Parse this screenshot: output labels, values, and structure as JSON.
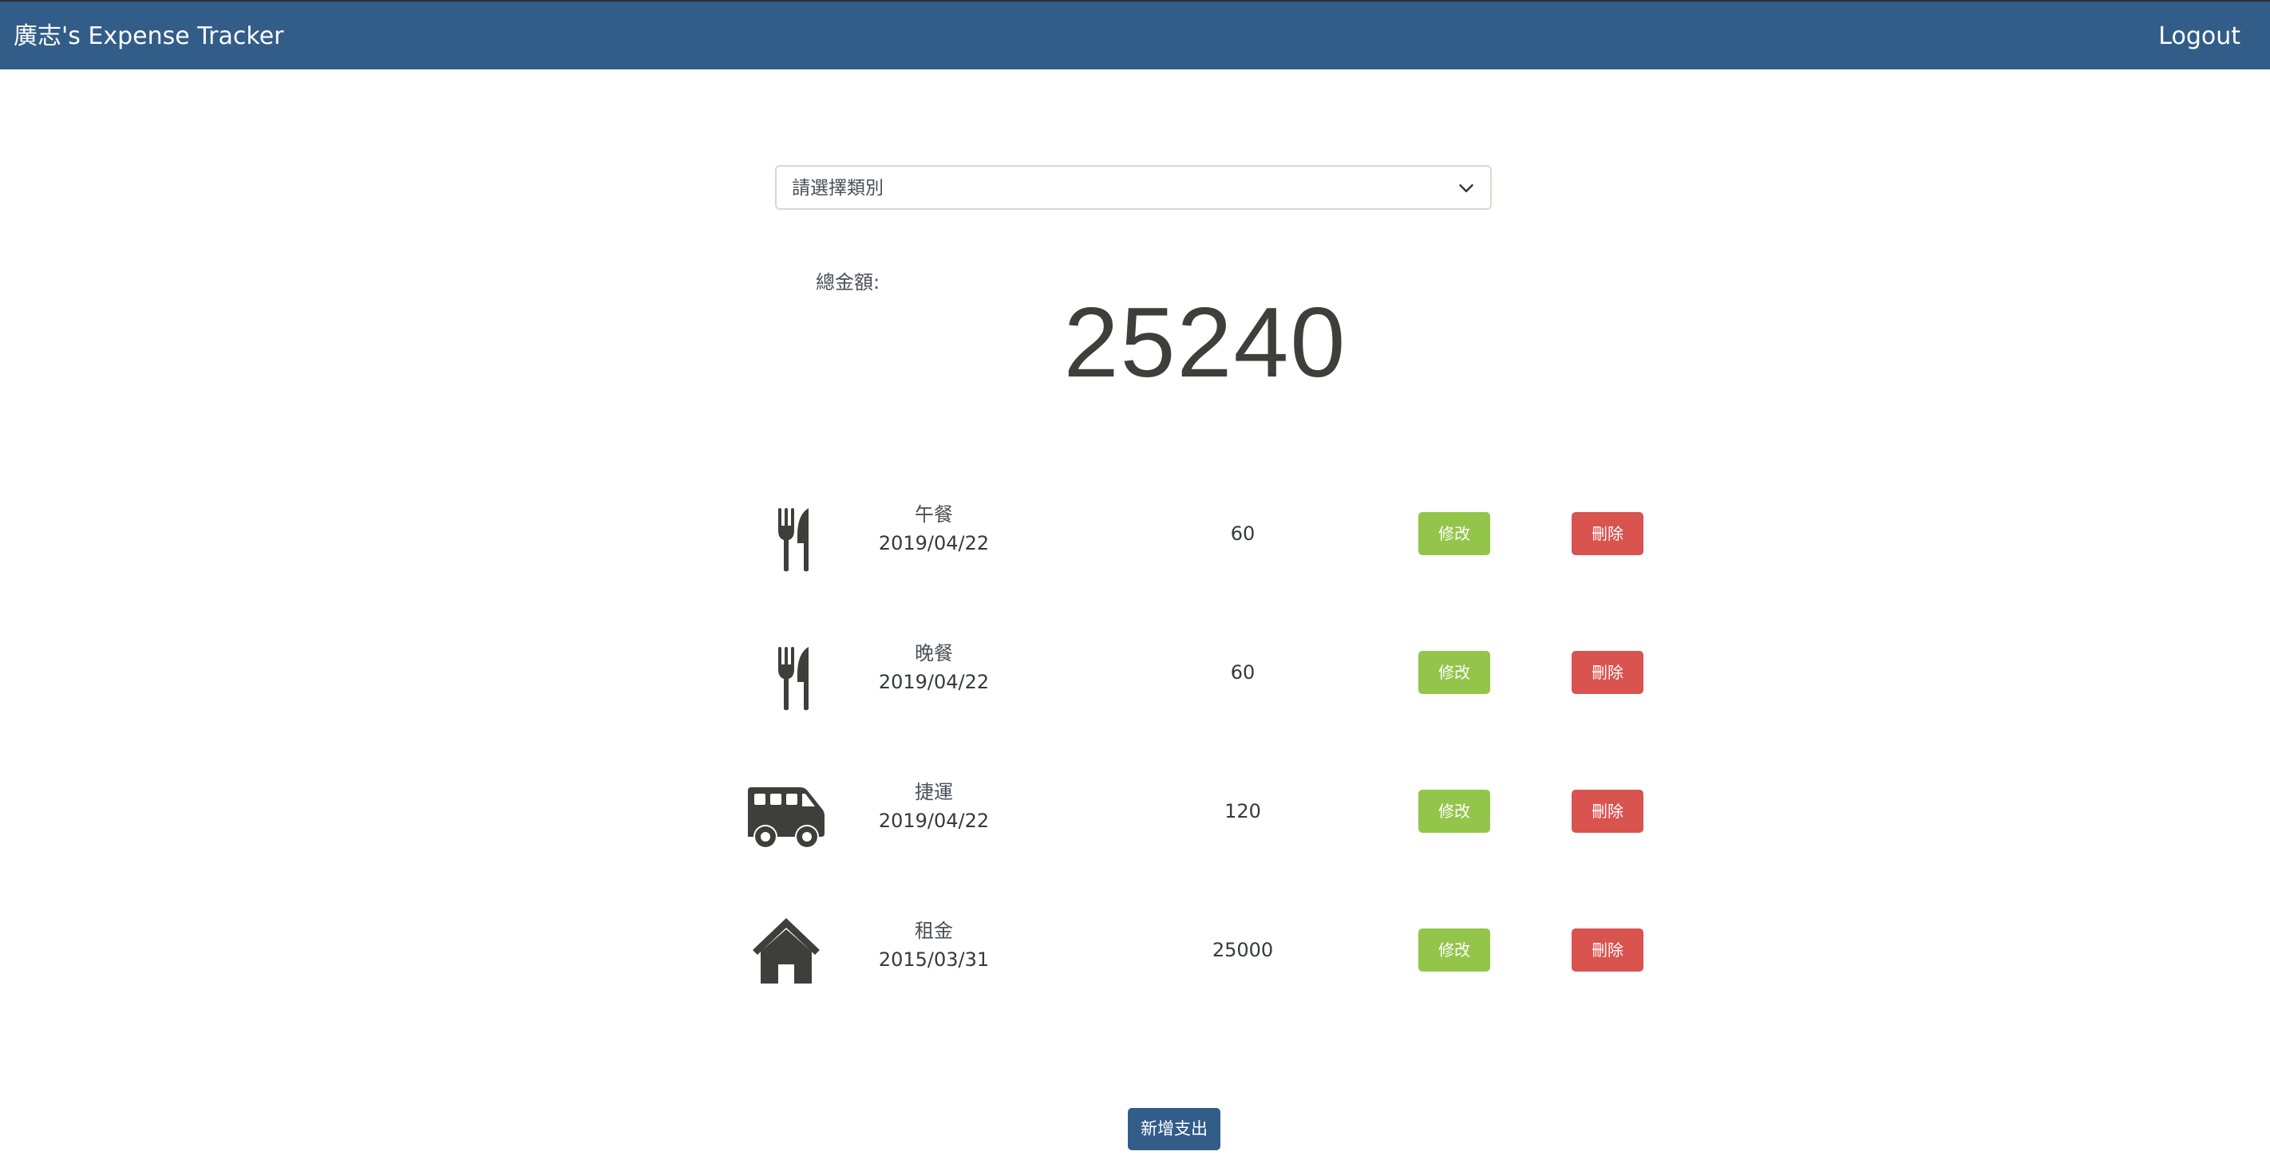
{
  "navbar": {
    "brand": "廣志's Expense Tracker",
    "logout_label": "Logout",
    "background_color": "#325d88"
  },
  "filter": {
    "placeholder": "請選擇類別",
    "arrow_icon": "chevron-down-icon"
  },
  "summary": {
    "label": "總金額:",
    "total": "25240"
  },
  "records": [
    {
      "icon": "utensils-icon",
      "category": "午餐",
      "date": "2019/04/22",
      "amount": "60",
      "edit_label": "修改",
      "delete_label": "刪除"
    },
    {
      "icon": "utensils-icon",
      "category": "晚餐",
      "date": "2019/04/22",
      "amount": "60",
      "edit_label": "修改",
      "delete_label": "刪除"
    },
    {
      "icon": "shuttle-van-icon",
      "category": "捷運",
      "date": "2019/04/22",
      "amount": "120",
      "edit_label": "修改",
      "delete_label": "刪除"
    },
    {
      "icon": "home-icon",
      "category": "租金",
      "date": "2015/03/31",
      "amount": "25000",
      "edit_label": "修改",
      "delete_label": "刪除"
    }
  ],
  "actions": {
    "add_label": "新增支出"
  },
  "colors": {
    "edit_button": "#93c54b",
    "delete_button": "#d9534f",
    "primary": "#325d88",
    "icon": "#3e3f3a"
  }
}
